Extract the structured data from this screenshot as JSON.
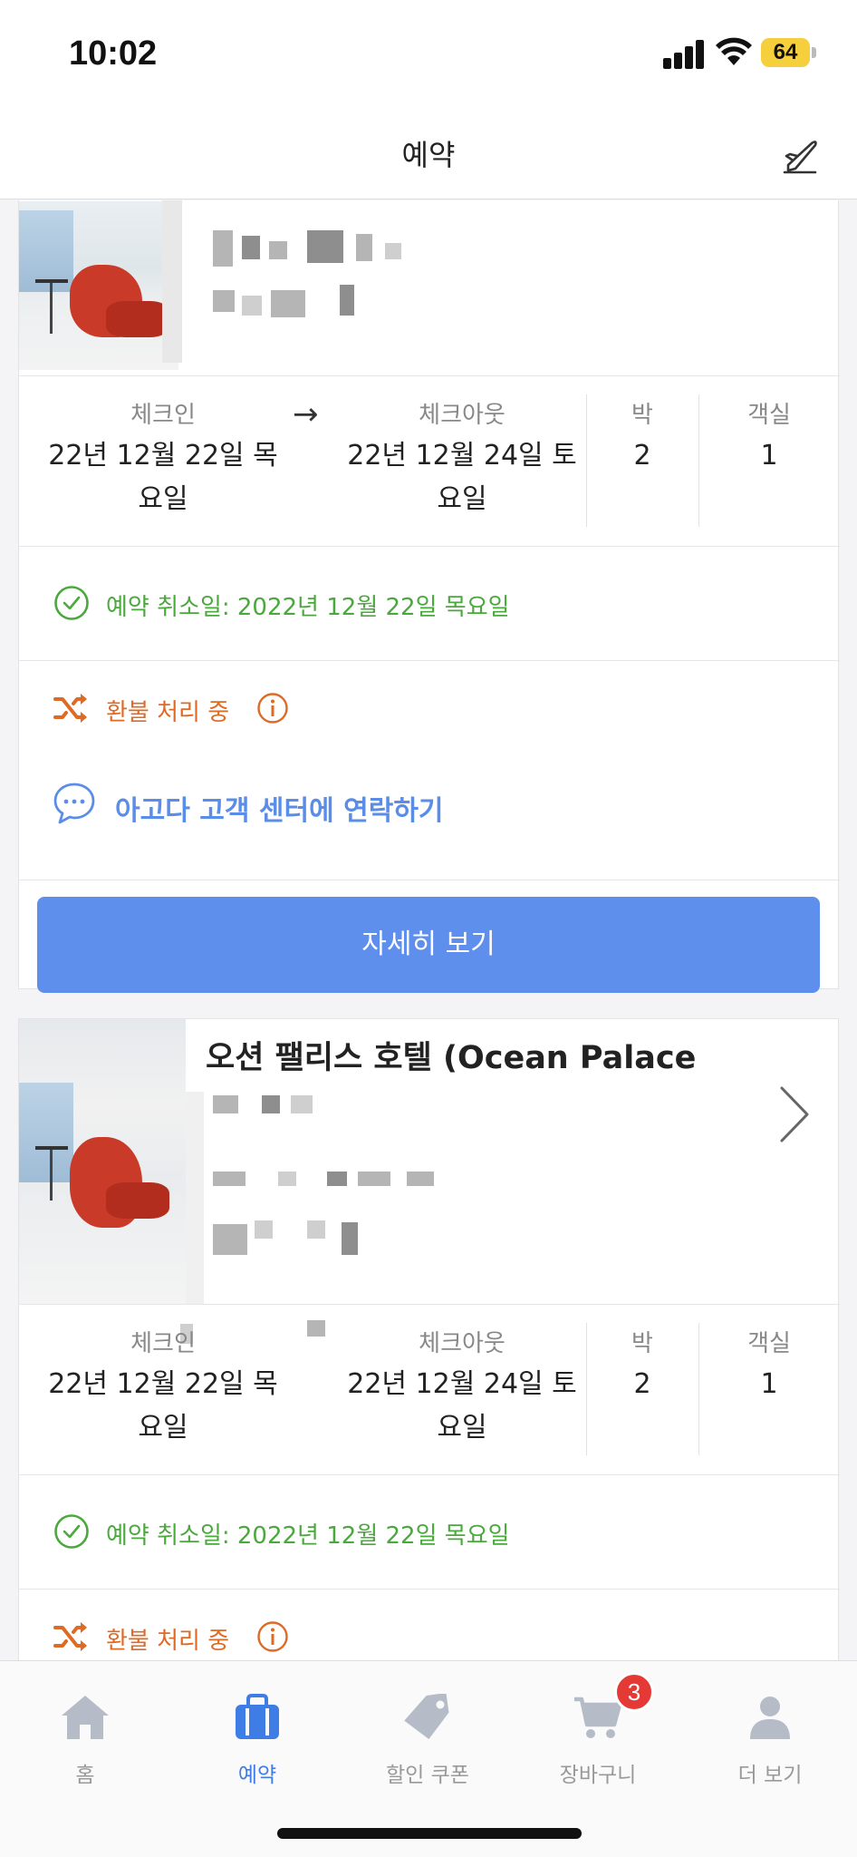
{
  "status_bar": {
    "time": "10:02",
    "battery": "64"
  },
  "header": {
    "title": "예약"
  },
  "bookings": [
    {
      "checkin_label": "체크인",
      "checkout_label": "체크아웃",
      "nights_label": "박",
      "rooms_label": "객실",
      "checkin_line1": "22년 12월 22일 목",
      "checkin_line2": "요일",
      "checkout_line1": "22년 12월 24일 토",
      "checkout_line2": "요일",
      "nights": "2",
      "rooms": "1",
      "cancel_status": "예약 취소일: 2022년 12월 22일 목요일",
      "refund_status": "환불 처리 중",
      "contact_label": "아고다 고객 센터에 연락하기",
      "detail_button": "자세히 보기"
    },
    {
      "hotel_name": "오션 팰리스 호텔 (Ocean Palace",
      "checkin_label": "체크인",
      "checkout_label": "체크아웃",
      "nights_label": "박",
      "rooms_label": "객실",
      "checkin_line1": "22년 12월 22일 목",
      "checkin_line2": "요일",
      "checkout_line1": "22년 12월 24일 토",
      "checkout_line2": "요일",
      "nights": "2",
      "rooms": "1",
      "cancel_status": "예약 취소일: 2022년 12월 22일 목요일",
      "refund_status": "환불 처리 중"
    }
  ],
  "tab_bar": {
    "tabs": [
      {
        "label": "홈",
        "icon": "home-icon"
      },
      {
        "label": "예약",
        "icon": "briefcase-icon",
        "active": true
      },
      {
        "label": "할인 쿠폰",
        "icon": "tag-icon"
      },
      {
        "label": "장바구니",
        "icon": "cart-icon",
        "badge": "3"
      },
      {
        "label": "더 보기",
        "icon": "person-icon"
      }
    ]
  },
  "colors": {
    "accent_blue": "#5f8fec",
    "cancel_green": "#4aa83d",
    "refund_orange": "#dd6a25",
    "badge_red": "#e53935"
  }
}
